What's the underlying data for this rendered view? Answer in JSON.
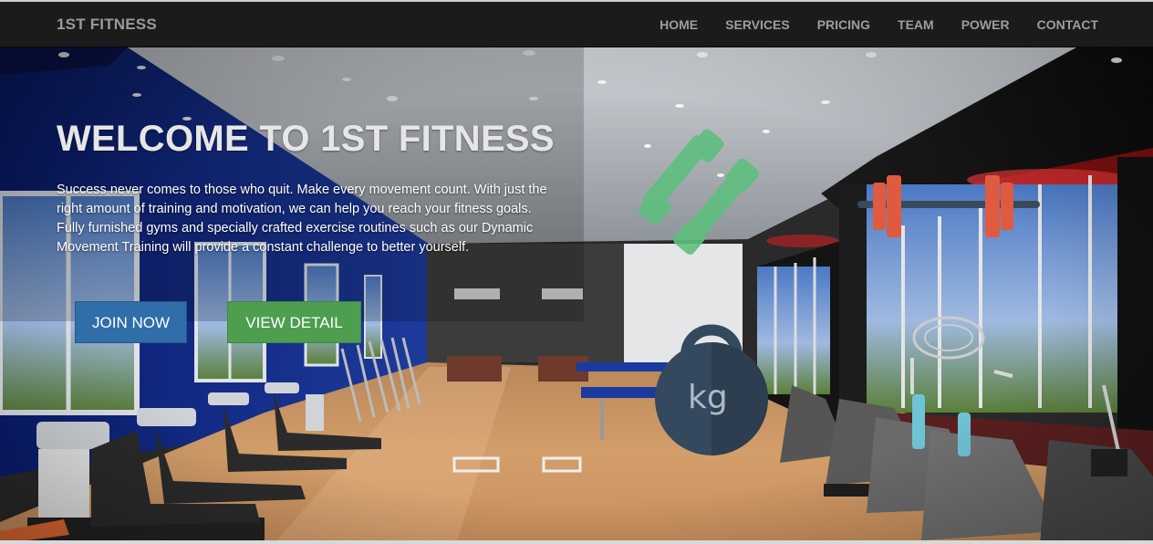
{
  "nav": {
    "brand": "1ST FITNESS",
    "items": [
      {
        "label": "HOME"
      },
      {
        "label": "SERVICES"
      },
      {
        "label": "PRICING"
      },
      {
        "label": "TEAM"
      },
      {
        "label": "POWER"
      },
      {
        "label": "CONTACT"
      }
    ]
  },
  "hero": {
    "title": "WELCOME TO 1ST FITNESS",
    "text": "Success never comes to those who quit. Make every movement count. With just the right amount of training and motivation, we can help you reach your fitness goals. Fully furnished gyms and specially crafted exercise routines such as our Dynamic Movement Training will provide a constant challenge to better yourself.",
    "join_label": "JOIN NOW",
    "detail_label": "VIEW DETAIL",
    "kettlebell_label": "kg"
  },
  "icons": {
    "dumbbell": "dumbbell-icon",
    "barbell": "barbell-icon",
    "kettlebell": "kettlebell-icon"
  },
  "colors": {
    "navbar": "#1b1b1b",
    "nav_text": "#9d9d9d",
    "join_button": "#2f6ea8",
    "detail_button": "#4d9e4f",
    "dumbbell": "#5fbf7f",
    "barbell": "#e05a3f",
    "kettlebell": "#34495e"
  }
}
